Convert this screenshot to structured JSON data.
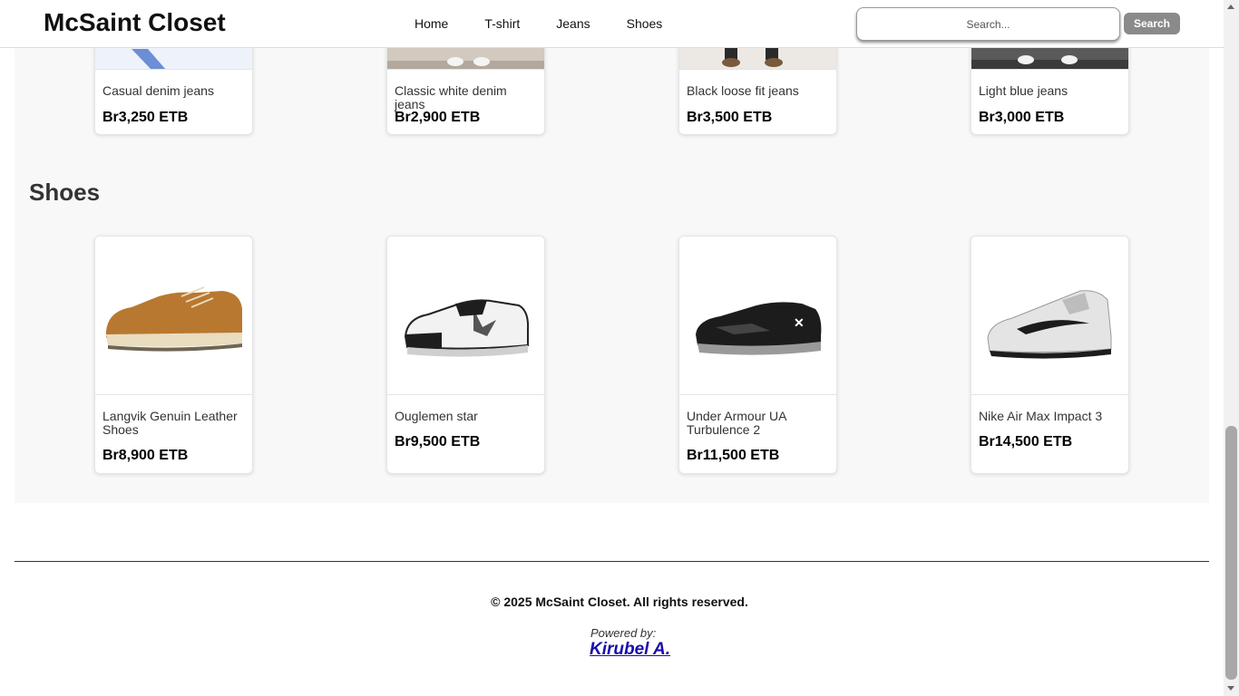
{
  "header": {
    "brand": "McSaint Closet",
    "nav": [
      "Home",
      "T-shirt",
      "Jeans",
      "Shoes"
    ],
    "search_placeholder": "Search...",
    "search_button": "Search"
  },
  "jeans": {
    "items": [
      {
        "name": "Casual denim jeans",
        "price": "Br3,250 ETB"
      },
      {
        "name": "Classic white denim jeans",
        "price": "Br2,900 ETB"
      },
      {
        "name": "Black loose fit jeans",
        "price": "Br3,500 ETB"
      },
      {
        "name": "Light blue jeans",
        "price": "Br3,000 ETB"
      }
    ]
  },
  "shoes": {
    "title": "Shoes",
    "items": [
      {
        "name": "Langvik Genuin Leather Shoes",
        "price": "Br8,900 ETB"
      },
      {
        "name": "Ouglemen star",
        "price": "Br9,500 ETB"
      },
      {
        "name": "Under Armour UA Turbulence 2",
        "price": "Br11,500 ETB"
      },
      {
        "name": "Nike Air Max Impact 3",
        "price": "Br14,500 ETB"
      }
    ]
  },
  "footer": {
    "copyright": "© 2025 McSaint Closet. All rights reserved.",
    "powered_by": "Powered by:",
    "author": "Kirubel A."
  },
  "colors": {
    "search_button": "#8a8a8a",
    "author_link": "#1a0dab",
    "content_bg": "#f8f8f8"
  }
}
